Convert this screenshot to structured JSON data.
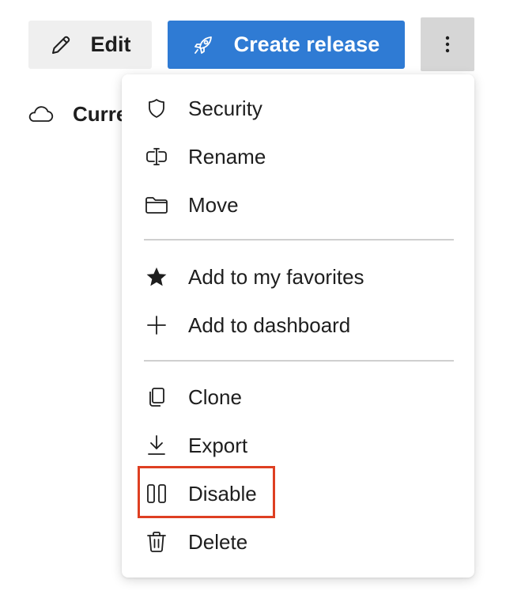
{
  "toolbar": {
    "edit_label": "Edit",
    "edit_icon": "pencil-icon",
    "create_release_label": "Create release",
    "create_release_icon": "rocket-icon",
    "more_icon": "more-vertical-icon",
    "accent_color": "#2f7bd4"
  },
  "breadcrumb": {
    "icon": "cloud-icon",
    "label": "Curre"
  },
  "menu": {
    "items": [
      {
        "label": "Security",
        "icon": "shield-icon"
      },
      {
        "label": "Rename",
        "icon": "rename-icon"
      },
      {
        "label": "Move",
        "icon": "folder-icon"
      },
      {
        "label": "Add to my favorites",
        "icon": "star-icon"
      },
      {
        "label": "Add to dashboard",
        "icon": "plus-icon"
      },
      {
        "label": "Clone",
        "icon": "copy-icon"
      },
      {
        "label": "Export",
        "icon": "download-icon"
      },
      {
        "label": "Disable",
        "icon": "pause-icon"
      },
      {
        "label": "Delete",
        "icon": "trash-icon"
      }
    ],
    "highlighted_item": "Disable",
    "highlight_color": "#de3f22"
  }
}
